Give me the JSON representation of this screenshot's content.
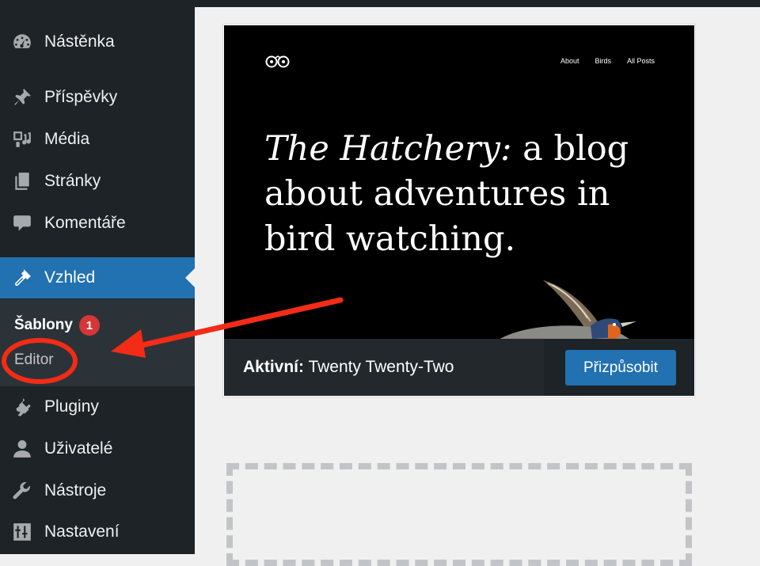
{
  "sidebar": {
    "items": [
      {
        "label": "Nástěnka",
        "icon": "dashboard-icon"
      },
      {
        "label": "Příspěvky",
        "icon": "pin-icon"
      },
      {
        "label": "Média",
        "icon": "media-icon"
      },
      {
        "label": "Stránky",
        "icon": "pages-icon"
      },
      {
        "label": "Komentáře",
        "icon": "comment-icon"
      },
      {
        "label": "Vzhled",
        "icon": "appearance-brush-icon",
        "active": true
      },
      {
        "label": "Pluginy",
        "icon": "plugin-icon"
      },
      {
        "label": "Uživatelé",
        "icon": "user-icon"
      },
      {
        "label": "Nástroje",
        "icon": "wrench-icon"
      },
      {
        "label": "Nastavení",
        "icon": "settings-sliders-icon"
      }
    ],
    "submenu": {
      "themes_label": "Šablony",
      "themes_badge": "1",
      "editor_label": "Editor"
    }
  },
  "theme_card": {
    "preview": {
      "nav": [
        "About",
        "Birds",
        "All Posts"
      ],
      "heading_italic": "The Hatchery:",
      "heading_rest": " a blog about adventures in bird watching."
    },
    "active_prefix": "Aktivní:",
    "active_theme": " Twenty Twenty-Two",
    "customize_label": "Přizpůsobit"
  },
  "colors": {
    "sidebar_bg": "#1d2327",
    "accent": "#2271b1",
    "badge": "#d63638",
    "annotation": "#f22c16"
  }
}
